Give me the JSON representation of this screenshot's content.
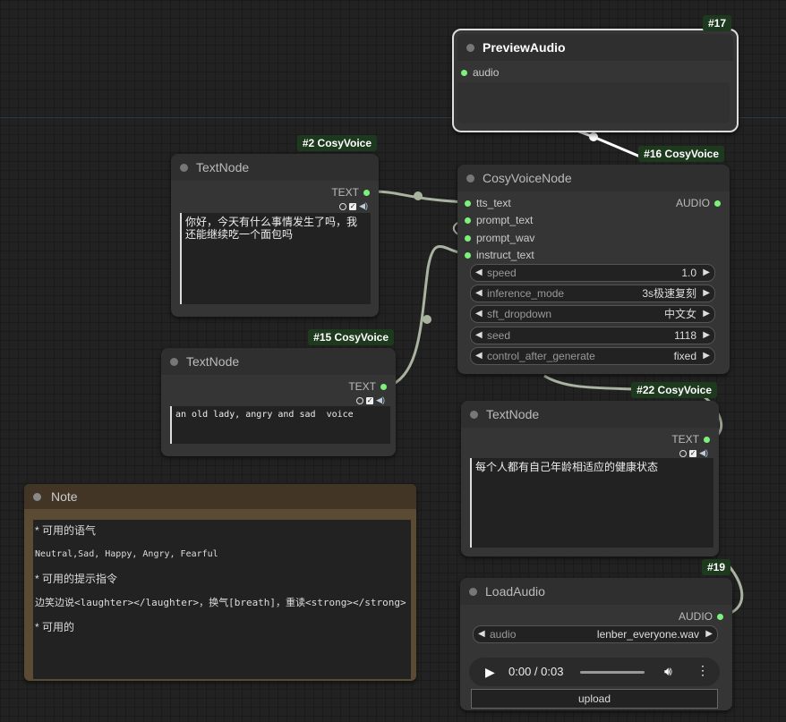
{
  "nodes": {
    "preview": {
      "badge": "#17",
      "title": "PreviewAudio",
      "input": "audio"
    },
    "textnode1": {
      "badge": "#2 CosyVoice",
      "title": "TextNode",
      "output": "TEXT",
      "text": "你好，今天有什么事情发生了吗，我还能继续吃一个面包吗"
    },
    "textnode2": {
      "badge": "#15 CosyVoice",
      "title": "TextNode",
      "output": "TEXT",
      "text": "an old lady, angry and sad  voice"
    },
    "cosy": {
      "badge": "#16 CosyVoice",
      "title": "CosyVoiceNode",
      "output": "AUDIO",
      "inputs": [
        "tts_text",
        "prompt_text",
        "prompt_wav",
        "instruct_text"
      ],
      "widgets": [
        {
          "label": "speed",
          "value": "1.0"
        },
        {
          "label": "inference_mode",
          "value": "3s极速复刻"
        },
        {
          "label": "sft_dropdown",
          "value": "中文女"
        },
        {
          "label": "seed",
          "value": "1118"
        },
        {
          "label": "control_after_generate",
          "value": "fixed"
        }
      ]
    },
    "textnode3": {
      "badge": "#22 CosyVoice",
      "title": "TextNode",
      "output": "TEXT",
      "text": "每个人都有自己年龄相适应的健康状态"
    },
    "loadaudio": {
      "badge": "#19",
      "title": "LoadAudio",
      "output": "AUDIO",
      "widget_label": "audio",
      "widget_value": "lenber_everyone.wav",
      "time": "0:00 / 0:03",
      "upload": "upload"
    }
  },
  "note": {
    "title": "Note",
    "lines": [
      "* 可用的语气",
      "Neutral,Sad, Happy, Angry, Fearful",
      "* 可用的提示指令",
      "边笑边说<laughter></laughter>，换气[breath]，重读<strong></strong>",
      "",
      "* 可用的"
    ]
  },
  "icons": {
    "play": "play-icon",
    "volume": "volume-icon",
    "more": "more-vert-icon"
  },
  "colors": {
    "slot": "#7cf27c",
    "wire": "#9aa89a",
    "badge": "#1e3a1e",
    "note": "#5a4b32"
  }
}
